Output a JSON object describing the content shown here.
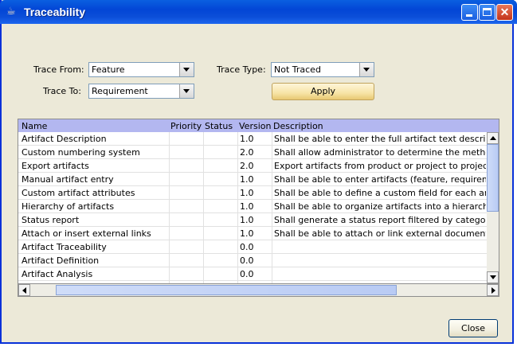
{
  "window": {
    "title": "Traceability"
  },
  "form": {
    "trace_from_label": "Trace From:",
    "trace_from_value": "Feature",
    "trace_to_label": "Trace To:",
    "trace_to_value": "Requirement",
    "trace_type_label": "Trace Type:",
    "trace_type_value": "Not Traced",
    "apply_label": "Apply"
  },
  "table": {
    "columns": [
      "Name",
      "Priority",
      "Status",
      "Version",
      "Description"
    ],
    "rows": [
      {
        "name": "Artifact Description",
        "priority": "",
        "status": "",
        "version": "1.0",
        "description": "Shall be able to enter the full artifact text description."
      },
      {
        "name": "Custom numbering system",
        "priority": "",
        "status": "",
        "version": "2.0",
        "description": "Shall allow administrator to determine the method for n"
      },
      {
        "name": "Export artifacts",
        "priority": "",
        "status": "",
        "version": "2.0",
        "description": "Export artifacts from product or project to project."
      },
      {
        "name": "Manual artifact entry",
        "priority": "",
        "status": "",
        "version": "1.0",
        "description": "Shall be able to enter artifacts (feature, requirement e"
      },
      {
        "name": "Custom artifact attributes",
        "priority": "",
        "status": "",
        "version": "1.0",
        "description": "Shall be able to define a custom field for each artifact"
      },
      {
        "name": "Hierarchy of artifacts",
        "priority": "",
        "status": "",
        "version": "1.0",
        "description": "Shall be able to organize artifacts into a hierarchy."
      },
      {
        "name": "Status report",
        "priority": "",
        "status": "",
        "version": "1.0",
        "description": "Shall generate a status report filtered by category and"
      },
      {
        "name": "Attach or insert external links",
        "priority": "",
        "status": "",
        "version": "1.0",
        "description": "Shall be able to attach or link external documents."
      },
      {
        "name": "Artifact Traceability",
        "priority": "",
        "status": "",
        "version": "0.0",
        "description": ""
      },
      {
        "name": "Artifact Definition",
        "priority": "",
        "status": "",
        "version": "0.0",
        "description": ""
      },
      {
        "name": "Artifact Analysis",
        "priority": "",
        "status": "",
        "version": "0.0",
        "description": ""
      }
    ]
  },
  "footer": {
    "close_label": "Close"
  },
  "colors": {
    "titlebar": "#0a5fe0",
    "header": "#b3b7f0",
    "dialog": "#ece9d8"
  },
  "icons": {
    "window": "java-cup-icon"
  }
}
